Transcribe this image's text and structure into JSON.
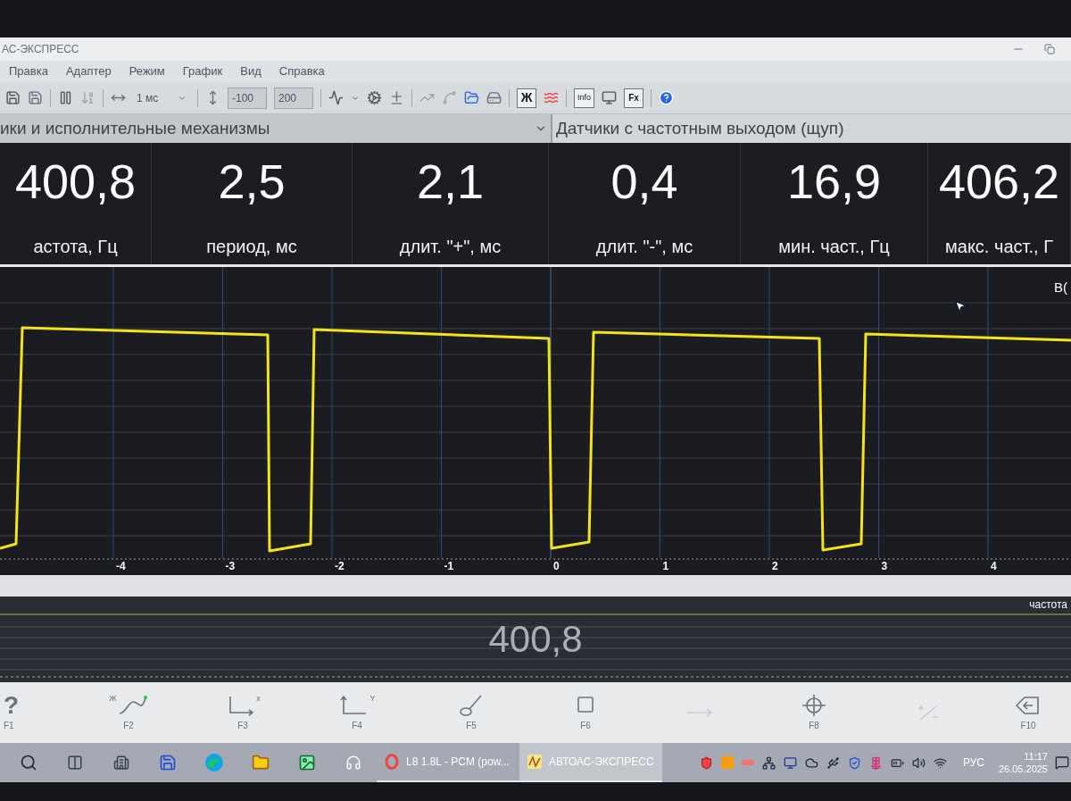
{
  "window": {
    "title": "АС-ЭКСПРЕСС"
  },
  "menu": [
    "Правка",
    "Адаптер",
    "Режим",
    "График",
    "Вид",
    "Справка"
  ],
  "toolbar": {
    "timebase": "1 мс",
    "y_min": "-100",
    "y_max": "200",
    "text_buttons": [
      "Ж",
      "Info",
      "Fx"
    ]
  },
  "panels": [
    {
      "title": "ики и исполнительные механизмы",
      "has_dropdown": true
    },
    {
      "title": "Датчики с частотным выходом (щуп)",
      "has_dropdown": false
    }
  ],
  "measurements": [
    {
      "value": "400,8",
      "label": "астота, Гц"
    },
    {
      "value": "2,5",
      "label": "период, мс"
    },
    {
      "value": "2,1",
      "label": "длит. \"+\", мс"
    },
    {
      "value": "0,4",
      "label": "длит. \"-\", мс"
    },
    {
      "value": "16,9",
      "label": "мин. част., Гц"
    },
    {
      "value": "406,2",
      "label": "макс. част., Г"
    }
  ],
  "plot": {
    "channel_label": "В(",
    "x_ticks": [
      "-4",
      "-3",
      "-2",
      "-1",
      "0",
      "1",
      "2",
      "3",
      "4"
    ]
  },
  "frequency_strip": {
    "label": "частота",
    "value": "400,8"
  },
  "function_keys": [
    {
      "key": "F1",
      "kind": "help",
      "glyph": "?",
      "disabled": false
    },
    {
      "key": "F2",
      "kind": "curve",
      "glyph": "Ж",
      "disabled": false
    },
    {
      "key": "F3",
      "kind": "x-axis",
      "glyph": "x",
      "disabled": false
    },
    {
      "key": "F4",
      "kind": "y-axis",
      "glyph": "Y",
      "disabled": false
    },
    {
      "key": "F5",
      "kind": "probe",
      "disabled": false
    },
    {
      "key": "F6",
      "kind": "square",
      "disabled": false
    },
    {
      "kind": "arrow",
      "disabled": true
    },
    {
      "key": "F8",
      "kind": "crosshair",
      "disabled": false
    },
    {
      "kind": "plus-minus",
      "disabled": true
    },
    {
      "key": "F10",
      "kind": "exit",
      "disabled": false
    }
  ],
  "taskbar": {
    "apps": [
      {
        "title": "L8 1.8L - PCM (pow...",
        "kind": "ring",
        "selected": false
      },
      {
        "title": "АВТОАС-ЭКСПРЕСС",
        "kind": "scope",
        "selected": true
      }
    ],
    "language": "РУС",
    "time": "11:17",
    "date": "26.05.2025"
  }
}
